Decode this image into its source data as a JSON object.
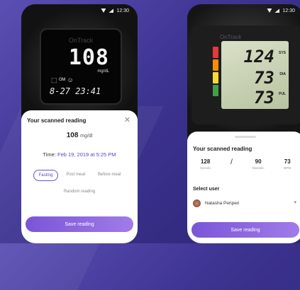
{
  "phone1": {
    "status_time": "12:30",
    "device": {
      "brand": "OnTrack",
      "value": "108",
      "unit": "mg/dL",
      "icons": "⬚ ᴳᴹ ☺",
      "time": "8-27 23:41"
    },
    "sheet": {
      "title": "Your scanned reading",
      "close_icon": "✕",
      "reading_value": "108",
      "reading_unit": "mg/dl",
      "time_label": "Time:",
      "time_value": "Feb 19, 2019 at 5:25 PM",
      "chips": [
        "Fasting",
        "Post meal",
        "Before meal"
      ],
      "chip_random": "Random reading",
      "save_button": "Save reading"
    }
  },
  "phone2": {
    "status_time": "12:30",
    "device": {
      "brand": "OnTrack",
      "sys": "124",
      "dia": "73",
      "pul": "73",
      "sys_label": "SYS",
      "dia_label": "DIA",
      "pul_label": "PUL"
    },
    "sheet": {
      "title": "Your scanned reading",
      "values": [
        {
          "num": "128",
          "label": "Systolic"
        },
        {
          "num": "90",
          "label": "Diastolic"
        },
        {
          "num": "73",
          "label": "BPM"
        }
      ],
      "separator": "/",
      "select_user_label": "Select user",
      "user_name": "Natasha Periperi",
      "save_button": "Save reading"
    }
  },
  "colors": {
    "accent": "#6a4fd8",
    "background": "#3d3391"
  }
}
